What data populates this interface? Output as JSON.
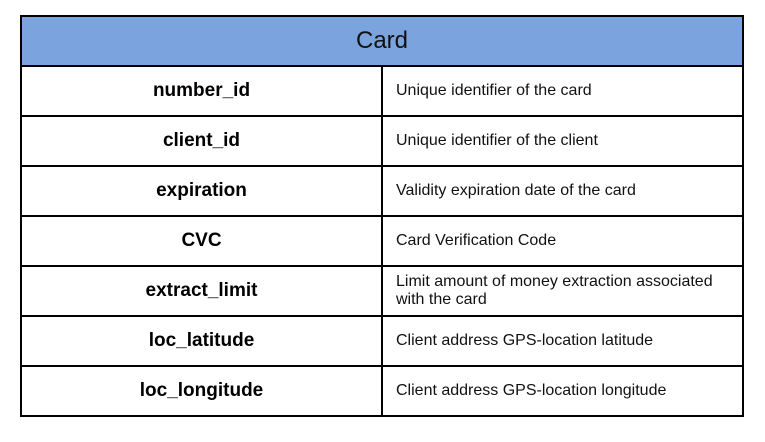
{
  "table": {
    "title": "Card",
    "rows": [
      {
        "field": "number_id",
        "description": "Unique identifier of the card"
      },
      {
        "field": "client_id",
        "description": "Unique identifier of the client"
      },
      {
        "field": "expiration",
        "description": "Validity expiration date of the card"
      },
      {
        "field": "CVC",
        "description": "Card Verification Code"
      },
      {
        "field": "extract_limit",
        "description": "Limit amount of money extraction associated with the card"
      },
      {
        "field": "loc_latitude",
        "description": "Client address GPS-location latitude"
      },
      {
        "field": "loc_longitude",
        "description": "Client address GPS-location longitude"
      }
    ],
    "header_color": "#7ba4de"
  }
}
